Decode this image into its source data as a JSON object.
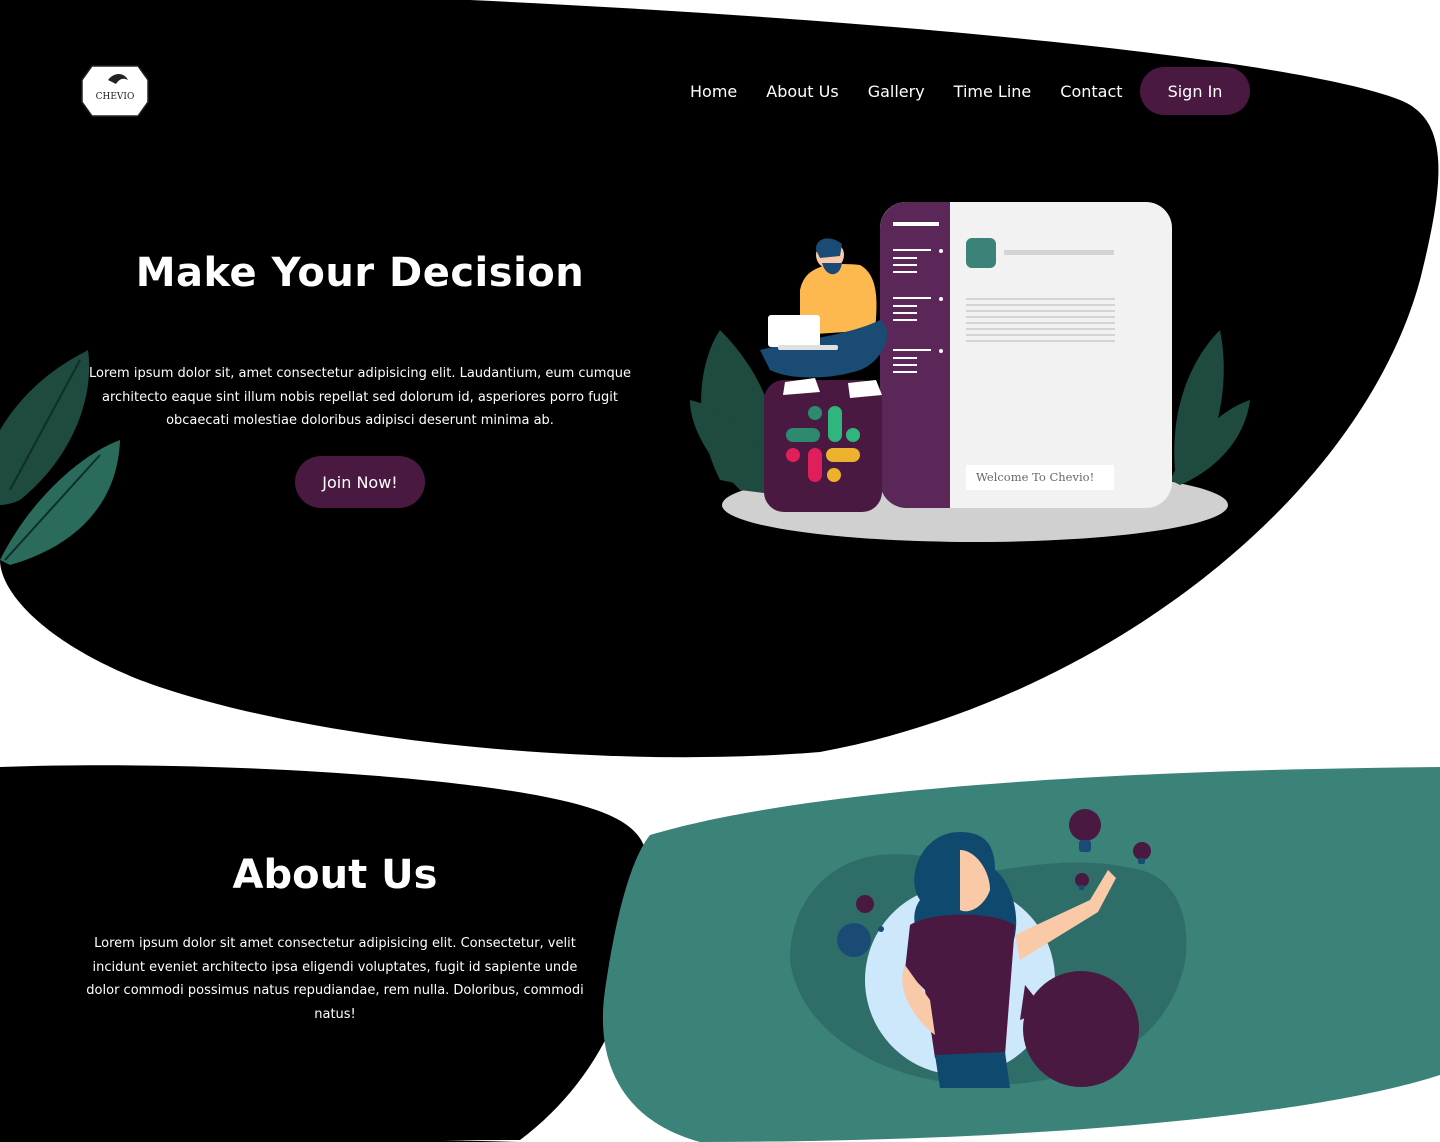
{
  "brand": {
    "name": "CHEVIO"
  },
  "nav": {
    "items": [
      {
        "label": "Home"
      },
      {
        "label": "About Us"
      },
      {
        "label": "Gallery"
      },
      {
        "label": "Time Line"
      },
      {
        "label": "Contact"
      }
    ],
    "signin_label": "Sign In"
  },
  "hero": {
    "title": "Make Your Decision",
    "text": "Lorem ipsum dolor sit, amet consectetur adipisicing elit. Laudantium, eum cumque architecto eaque sint illum nobis repellat sed dolorum id, asperiores porro fugit obcaecati molestiae doloribus adipisci deserunt minima ab.",
    "cta_label": "Join Now!",
    "illustration_caption": "Welcome To Chevio!"
  },
  "about": {
    "title": "About Us",
    "text": "Lorem ipsum dolor sit amet consectetur adipisicing elit. Consectetur, velit incidunt eveniet architecto ipsa eligendi voluptates, fugit id sapiente unde dolor commodi possimus natus repudiandae, rem nulla. Doloribus, commodi natus!"
  },
  "colors": {
    "background": "#000000",
    "accent_purple": "#4a1942",
    "accent_teal": "#3b8279",
    "leaf_green": "#1e4a40"
  }
}
